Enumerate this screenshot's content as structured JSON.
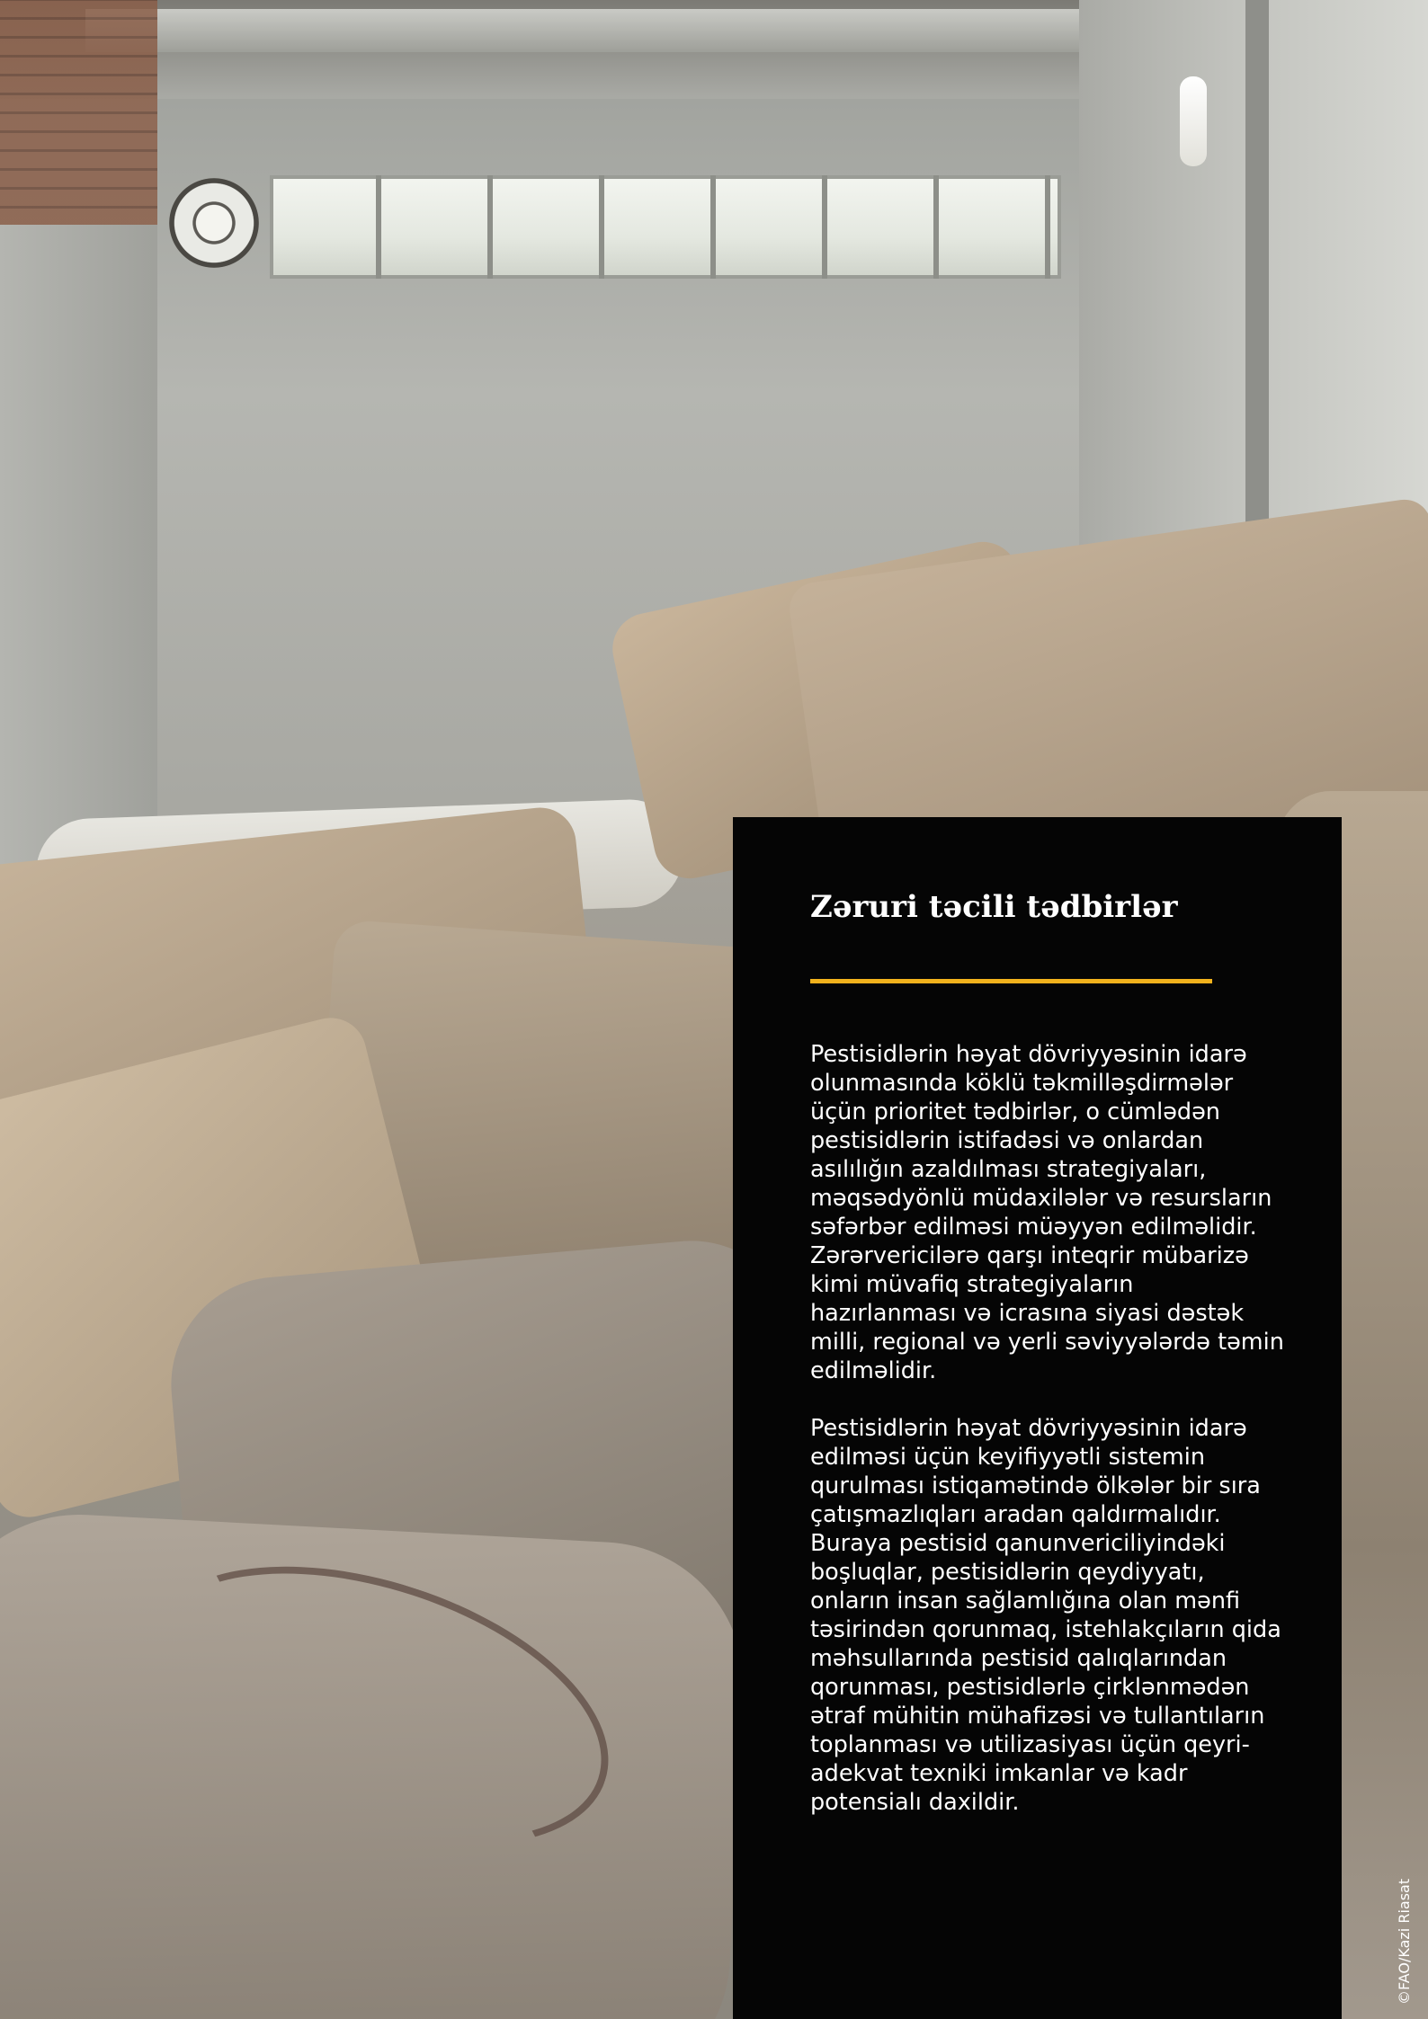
{
  "panel": {
    "title": "Zəruri təcili tədbirlər",
    "accent_color": "#f2b21c",
    "paragraphs": [
      "Pestisidlərin həyat dövriyyəsinin idarə olunmasında köklü təkmilləşdirmələr üçün prioritet tədbirlər, o cümlədən pestisidlərin istifadəsi və onlardan asılılığın azaldılması strategiyaları, məqsədyönlü müdaxilələr və resursların səfərbər edilməsi müəyyən edilməlidir. Zərərvericilərə qarşı inteqrir mübarizə kimi müvafiq strategiyaların hazırlanması və icrasına siyasi dəstək milli, regional və yerli səviyyələrdə təmin edilməlidir.",
      "Pestisidlərin həyat dövriyyəsinin idarə edilməsi üçün keyifiyyətli sistemin qurulması istiqamətində ölkələr bir sıra çatışmazlıqları aradan qaldırmalıdır. Buraya pestisid qanunvericiliyindəki boşluqlar, pestisidlərin qeydiyyatı, onların insan sağlamlığına olan mənfi təsirindən qorunmaq, istehlakçıların qida məhsullarında pestisid qalıqlarından  qorunması, pestisidlərlə çirklənmədən ətraf mühitin mühafizəsi və tullantıların toplanması və utilizasiyası üçün qeyri-adekvat texniki imkanlar və kadr potensialı daxildir."
    ]
  },
  "photo": {
    "credit": "©FAO/Kazi Riasat"
  }
}
